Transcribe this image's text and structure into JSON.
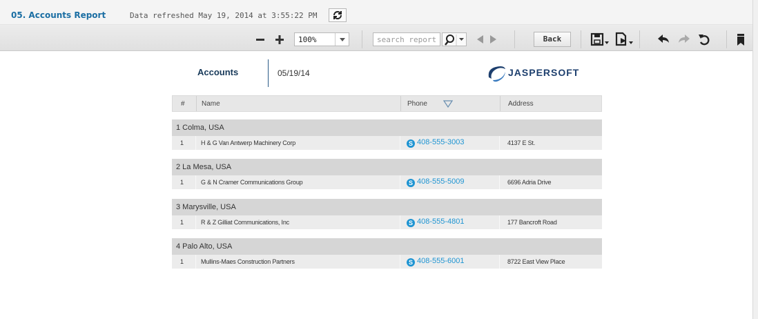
{
  "header": {
    "title": "05. Accounts Report",
    "refresh_text": "Data refreshed May 19, 2014 at 3:55:22 PM"
  },
  "toolbar": {
    "zoom": "100%",
    "search_placeholder": "search report",
    "back_label": "Back"
  },
  "report": {
    "title": "Accounts",
    "date": "05/19/14",
    "logo_text": "JASPERSOFT",
    "columns": [
      "#",
      "Name",
      "Phone",
      "Address"
    ],
    "groups": [
      {
        "label": "1  Colma, USA",
        "rows": [
          {
            "num": "1",
            "name": "H & G Van Antwerp Machinery Corp",
            "phone": "408-555-3003",
            "address": "4137 E St."
          }
        ]
      },
      {
        "label": "2  La Mesa, USA",
        "rows": [
          {
            "num": "1",
            "name": "G & N Cramer Communications Group",
            "phone": "408-555-5009",
            "address": "6696 Adria Drive"
          }
        ]
      },
      {
        "label": "3  Marysville, USA",
        "rows": [
          {
            "num": "1",
            "name": "R & Z Gilliat Communications, Inc",
            "phone": "408-555-4801",
            "address": "177 Bancroft Road"
          }
        ]
      },
      {
        "label": "4  Palo Alto, USA",
        "rows": [
          {
            "num": "1",
            "name": "Mullins-Maes Construction Partners",
            "phone": "408-555-6001",
            "address": "8722 East View Place"
          }
        ]
      }
    ]
  },
  "colors": {
    "accent": "#1b6ea3",
    "link": "#1e94d2",
    "group_bg": "#d6d6d6",
    "row_bg": "#ececec"
  }
}
